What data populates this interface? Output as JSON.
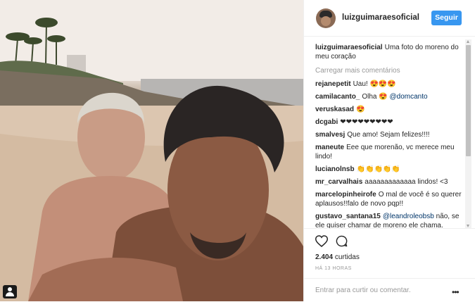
{
  "header": {
    "username": "luizguimaraesoficial",
    "follow_label": "Seguir"
  },
  "caption": {
    "username": "luizguimaraesoficial",
    "text": "Uma foto do moreno do meu coração"
  },
  "load_more": "Carregar mais comentários",
  "comments": [
    {
      "user": "rejanepetit",
      "text": "Uau! 😍😍😍"
    },
    {
      "user": "camilacanto_",
      "text": "Olha 😍 ",
      "mention": "@domcanto"
    },
    {
      "user": "veruskasad",
      "text": "😍"
    },
    {
      "user": "dcgabi",
      "text": "❤❤❤❤❤❤❤❤❤"
    },
    {
      "user": "smalvesj",
      "text": "Que amo! Sejam felizes!!!!"
    },
    {
      "user": "maneute",
      "text": "Eee que morenão, vc merece meu lindo!"
    },
    {
      "user": "lucianolnsb",
      "text": "👏👏👏👏👏"
    },
    {
      "user": "mr_carvalhais",
      "text": "aaaaaaaaaaaaa lindos! <3"
    },
    {
      "user": "marcelopinheirofe",
      "text": "O mal de você é so querer aplausos!!falo de novo pqp!!"
    },
    {
      "user": "gustavo_santana15",
      "text": " não, se ele quiser chamar de moreno ele chama.",
      "mention": "@leandroleobsb"
    }
  ],
  "likes": {
    "count": "2.404",
    "word": "curtidas"
  },
  "timestamp": "HÁ 13 HORAS",
  "add_comment": {
    "text": "Entrar para curtir ou comentar."
  },
  "icons": {
    "heart": "heart-icon",
    "comment": "comment-icon",
    "more": "more-options-icon",
    "user_tag": "user-tag-icon"
  },
  "colors": {
    "follow": "#3897f0",
    "mention": "#003569",
    "muted": "#999999"
  }
}
